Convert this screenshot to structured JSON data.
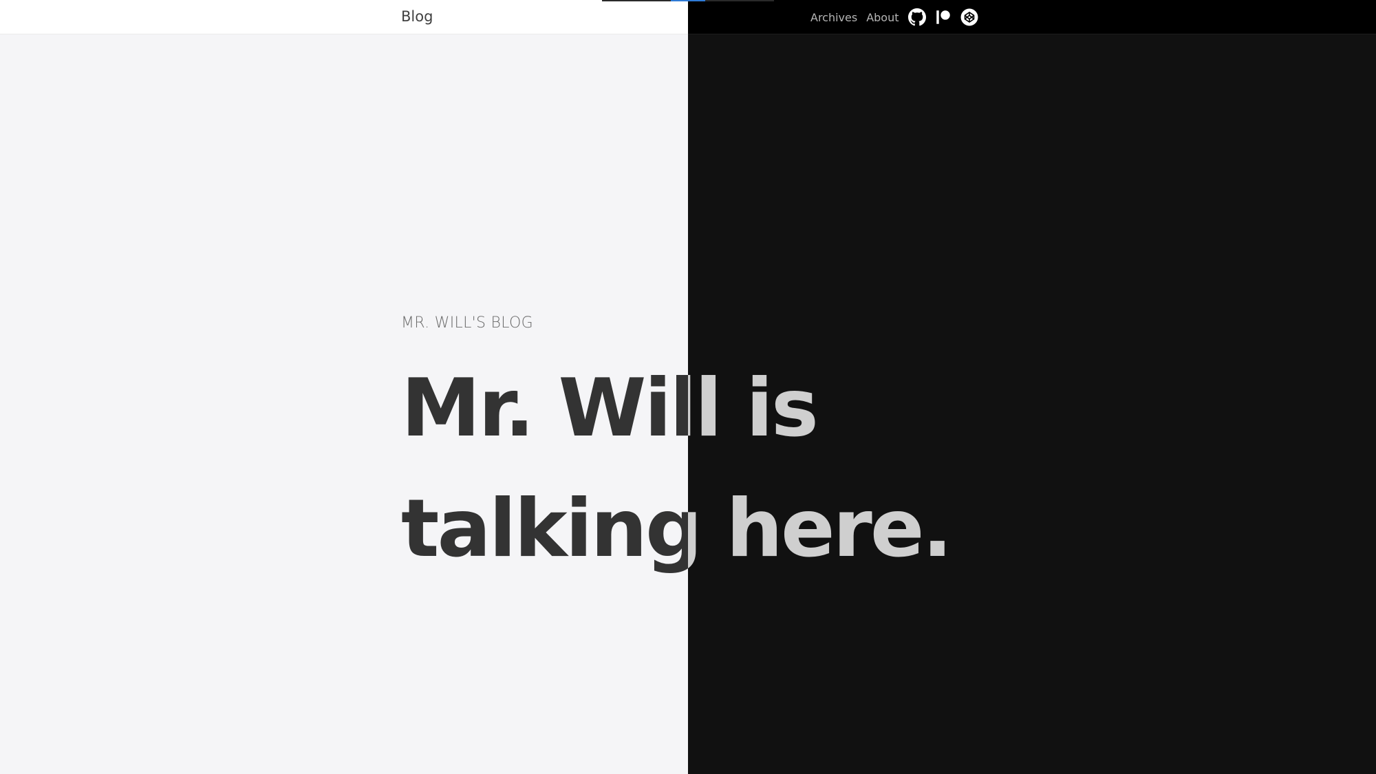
{
  "nav": {
    "brand": "Blog",
    "links": [
      "Archives",
      "About"
    ],
    "icons": [
      "github-icon",
      "patreon-icon",
      "codepen-icon"
    ]
  },
  "hero": {
    "subheading": "MR. WILL'S BLOG",
    "headline": "Mr. Will is talking here."
  },
  "theme": {
    "light_background": "#f5f5f7",
    "dark_background": "#111111",
    "light_text": "#333333",
    "dark_text": "#cfcfcf",
    "progress_accent": "#2f7bd6"
  }
}
